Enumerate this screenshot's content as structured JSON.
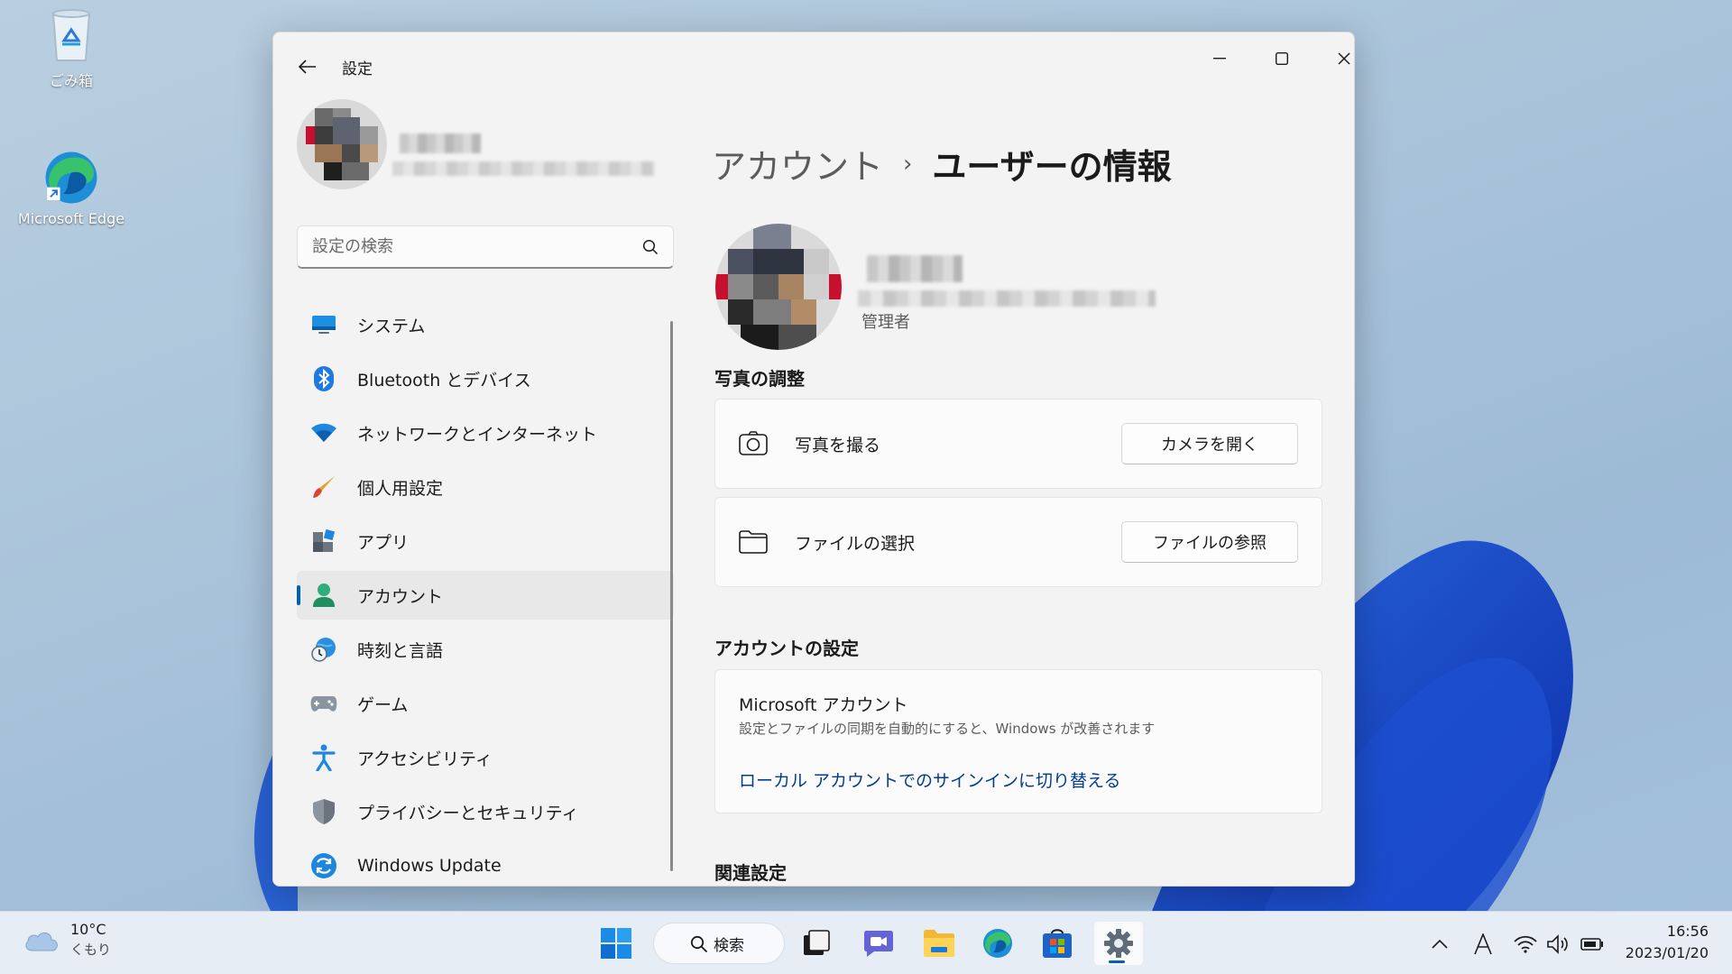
{
  "desktop": {
    "icons": [
      {
        "label": "ごみ箱"
      },
      {
        "label": "Microsoft Edge"
      }
    ]
  },
  "window": {
    "app_title": "設定",
    "search": {
      "placeholder": "設定の検索",
      "value": ""
    },
    "nav": [
      {
        "label": "システム",
        "icon": "display-icon"
      },
      {
        "label": "Bluetooth とデバイス",
        "icon": "bluetooth-icon"
      },
      {
        "label": "ネットワークとインターネット",
        "icon": "wifi-icon"
      },
      {
        "label": "個人用設定",
        "icon": "brush-icon"
      },
      {
        "label": "アプリ",
        "icon": "apps-icon"
      },
      {
        "label": "アカウント",
        "icon": "person-icon",
        "active": true
      },
      {
        "label": "時刻と言語",
        "icon": "globe-clock-icon"
      },
      {
        "label": "ゲーム",
        "icon": "gamepad-icon"
      },
      {
        "label": "アクセシビリティ",
        "icon": "accessibility-icon"
      },
      {
        "label": "プライバシーとセキュリティ",
        "icon": "shield-icon"
      },
      {
        "label": "Windows Update",
        "icon": "update-icon"
      }
    ],
    "breadcrumb": {
      "parent": "アカウント",
      "separator": "›",
      "current": "ユーザーの情報"
    },
    "user": {
      "role": "管理者"
    },
    "photo_section": {
      "heading": "写真の調整",
      "take_photo": {
        "label": "写真を撮る",
        "button": "カメラを開く"
      },
      "choose_file": {
        "label": "ファイルの選択",
        "button": "ファイルの参照"
      }
    },
    "account_section": {
      "heading": "アカウントの設定",
      "title": "Microsoft アカウント",
      "description": "設定とファイルの同期を自動的にすると、Windows が改善されます",
      "link": "ローカル アカウントでのサインインに切り替える"
    },
    "related_section": {
      "heading": "関連設定"
    }
  },
  "taskbar": {
    "weather": {
      "temp": "10°C",
      "condition": "くもり"
    },
    "search_label": "検索",
    "clock": {
      "time": "16:56",
      "date": "2023/01/20"
    }
  },
  "colors": {
    "accent": "#005fb8",
    "link": "#003e92"
  }
}
